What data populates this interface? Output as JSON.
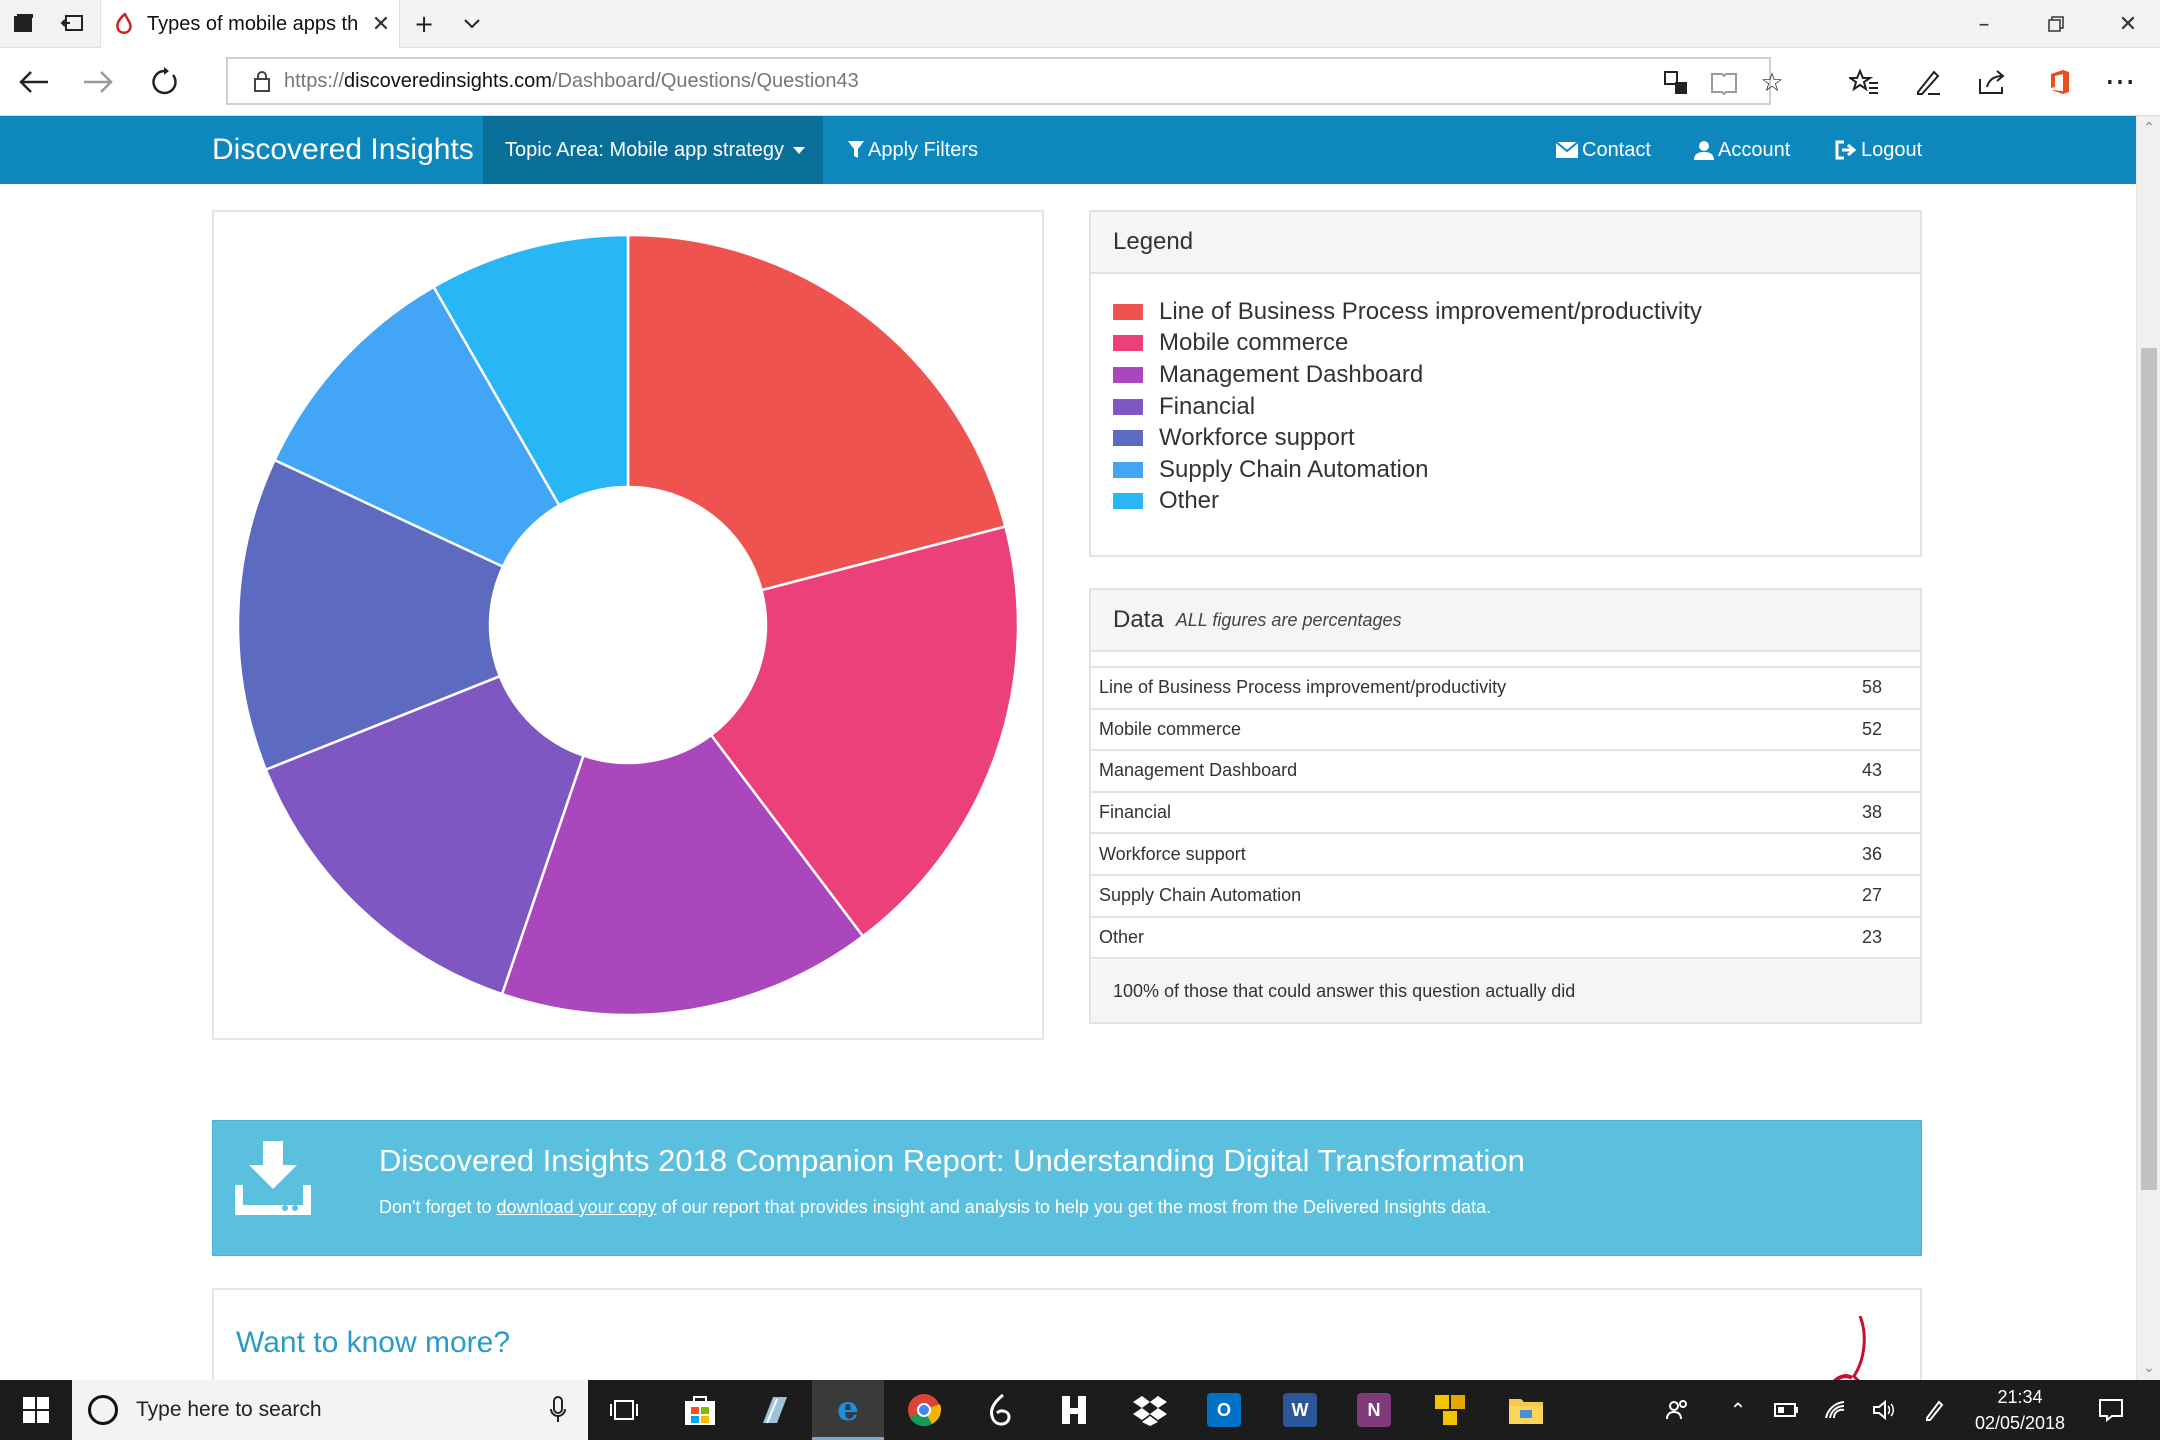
{
  "browser": {
    "tab_title": "Types of mobile apps th",
    "url_prefix": "https://",
    "url_host": "discoveredinsights.com",
    "url_path": "/Dashboard/Questions/Question43"
  },
  "header": {
    "brand": "Discovered Insights",
    "topic": "Topic Area: Mobile app strategy",
    "apply_filters": "Apply Filters",
    "contact": "Contact",
    "account": "Account",
    "logout": "Logout",
    "color": "#0e87bd"
  },
  "legend": {
    "title": "Legend",
    "items": [
      {
        "label": "Line of Business Process improvement/productivity",
        "color": "#ef5350"
      },
      {
        "label": "Mobile commerce",
        "color": "#ec407a"
      },
      {
        "label": "Management Dashboard",
        "color": "#ab47bc"
      },
      {
        "label": "Financial",
        "color": "#7e57c2"
      },
      {
        "label": "Workforce support",
        "color": "#5c6bc0"
      },
      {
        "label": "Supply Chain Automation",
        "color": "#42a5f5"
      },
      {
        "label": "Other",
        "color": "#29b6f6"
      }
    ]
  },
  "data_panel": {
    "title": "Data",
    "note": "ALL figures are percentages",
    "rows": [
      {
        "label": "Line of Business Process improvement/productivity",
        "value": "58"
      },
      {
        "label": "Mobile commerce",
        "value": "52"
      },
      {
        "label": "Management Dashboard",
        "value": "43"
      },
      {
        "label": "Financial",
        "value": "38"
      },
      {
        "label": "Workforce support",
        "value": "36"
      },
      {
        "label": "Supply Chain Automation",
        "value": "27"
      },
      {
        "label": "Other",
        "value": "23"
      }
    ],
    "footer": "100% of those that could answer this question actually did"
  },
  "chart_data": {
    "type": "pie",
    "donut": true,
    "categories": [
      "Line of Business Process improvement/productivity",
      "Mobile commerce",
      "Management Dashboard",
      "Financial",
      "Workforce support",
      "Supply Chain Automation",
      "Other"
    ],
    "values": [
      58,
      52,
      43,
      38,
      36,
      27,
      23
    ],
    "colors": [
      "#ef5350",
      "#ec407a",
      "#ab47bc",
      "#7e57c2",
      "#5c6bc0",
      "#42a5f5",
      "#29b6f6"
    ],
    "legend": "separate-panel-right"
  },
  "banner": {
    "title": "Discovered Insights 2018 Companion Report: Understanding Digital Transformation",
    "text_before": "Don't forget to ",
    "link": "download your copy",
    "text_after": " of our report that provides insight and analysis to help you get the most from the Delivered Insights data."
  },
  "more": {
    "title": "Want to know more?"
  },
  "taskbar": {
    "search_placeholder": "Type here to search",
    "time": "21:34",
    "date": "02/05/2018"
  }
}
